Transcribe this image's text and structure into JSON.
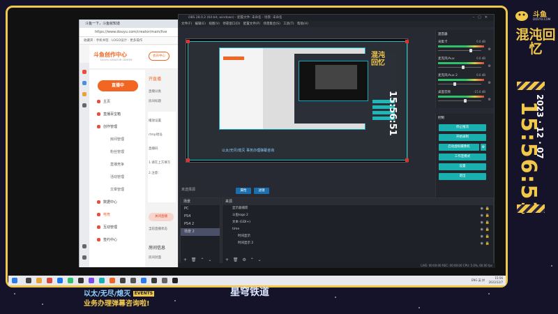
{
  "browser": {
    "tab_title": "斗鱼一下，斗鱼就知道",
    "url": "https://www.douyu.com/creator/main/live",
    "bookmarks": "收藏夹  · 手机书签  · LOGO设计  · 更多操作",
    "logo": "斗鱼创作中心",
    "logo_sub": "DOUYU CREATOR CENTER",
    "fan_button": "会员中心",
    "live_button": "直播中",
    "nav": [
      {
        "label": "主页",
        "type": "main"
      },
      {
        "label": "直播百宝箱",
        "type": "main"
      },
      {
        "label": "创作管理",
        "type": "main"
      },
      {
        "label": "房间管理",
        "type": "sub"
      },
      {
        "label": "粉丝管理",
        "type": "sub"
      },
      {
        "label": "直播竞争",
        "type": "sub"
      },
      {
        "label": "活动管理",
        "type": "sub"
      },
      {
        "label": "文章管理",
        "type": "sub"
      },
      {
        "label": "数据中心",
        "type": "main"
      },
      {
        "label": "电竞",
        "type": "main",
        "active": true
      },
      {
        "label": "互动管理",
        "type": "main"
      },
      {
        "label": "签约中心",
        "type": "main"
      }
    ],
    "main_title": "开直播",
    "main_items": [
      "直播分类",
      "房间标题",
      "播放设置",
      "rtmp地址",
      "直播码",
      "1.请在上方填写",
      "2.注意：",
      "关闭直播",
      "当前直播状态"
    ],
    "close_live": "关闭直播",
    "room_info_title": "房间信息",
    "room_info_item": "房间封面"
  },
  "obs": {
    "title": "OBS 28.0.2 (64-bit, windows) - 配置文件: 未命名 - 场景: 未命名",
    "menu": [
      "文件(F)",
      "编辑(E)",
      "视图(V)",
      "停靠窗口(D)",
      "配置文件(P)",
      "场景集合(S)",
      "工具(T)",
      "帮助(H)"
    ],
    "scene_label": "未选择源",
    "properties_button": "属性",
    "filters_button": "滤镜",
    "scenes_header": "场景",
    "scenes": [
      "PC",
      "PS4",
      "PS4 2",
      "场景 2"
    ],
    "active_scene_index": 3,
    "sources_header": "来源",
    "sources": [
      "显示器捕获",
      "斗鱼logo 2",
      "文本 (GDI+)",
      "time",
      "时间显示",
      "时间显示 2"
    ],
    "mixer_header": "混音器",
    "mixer": [
      {
        "name": "采集卡",
        "db": "0.0 dB",
        "level": 0.72
      },
      {
        "name": "麦克风/Aux",
        "db": "0.0 dB",
        "level": 0.55
      },
      {
        "name": "麦克风/Aux 2",
        "db": "0.0 dB",
        "level": 0.35
      },
      {
        "name": "桌面音频",
        "db": "-15.0 dB",
        "level": 0.6
      }
    ],
    "controls_header": "控制",
    "controls": [
      "停止推流",
      "开始录制",
      "启动虚拟摄像机",
      "工作室模式",
      "设置",
      "退出"
    ],
    "status": "LIVE: 00:00:00     REC: 00:00:00     CPU: 5.0%, 60.00 fps",
    "preview_text_1": "15:56:51",
    "preview_text_2": "混沌回忆",
    "preview_caption": "以太/无尽/熄灭  事务办理弹幕咨询"
  },
  "overlay": {
    "douyu_logo": "斗鱼",
    "douyu_sub": "DOUYU.COM",
    "title": "混沌回忆",
    "date": "2023 · 12 · 07",
    "time": "15:56:51",
    "events_line1": "以太/无尽/熄灭",
    "events_tag": "EVENTS",
    "events_line2": "业务办理弹幕咨询啦!",
    "game_title": "星穹铁道",
    "game_sub": "崩坏"
  },
  "taskbar": {
    "tray": "ENG 英 拼",
    "clock_time": "15:56",
    "clock_date": "2023/12/7"
  },
  "colors": {
    "accent_yellow": "#f2c84b",
    "douyu_orange": "#f26522",
    "obs_teal": "#1ab0b0",
    "obs_blue": "#1b6fae"
  }
}
